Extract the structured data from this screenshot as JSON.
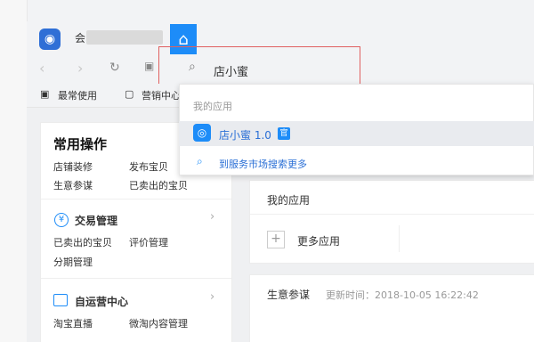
{
  "window": {
    "shop_prefix": "会",
    "home_icon": "home-icon"
  },
  "nav": {
    "search_value": "店小蜜"
  },
  "toolbar": {
    "frequent": "最常使用",
    "marketing": "营销中心"
  },
  "dropdown": {
    "section": "我的应用",
    "app_name": "店小蜜 1.0",
    "badge": "官",
    "more": "到服务市场搜索更多"
  },
  "left": {
    "common_title": "常用操作",
    "common_links": [
      "店铺装修",
      "发布宝贝",
      "生意参谋",
      "已卖出的宝贝"
    ],
    "trade_title": "交易管理",
    "trade_links": [
      "已卖出的宝贝",
      "评价管理",
      "分期管理"
    ],
    "self_title": "自运营中心",
    "self_links": [
      "淘宝直播",
      "微淘内容管理"
    ]
  },
  "main": {
    "apps_title": "我的应用",
    "more_apps": "更多应用",
    "biz_title": "生意参谋",
    "update_label": "更新时间：2018-10-05 16:22:42"
  }
}
